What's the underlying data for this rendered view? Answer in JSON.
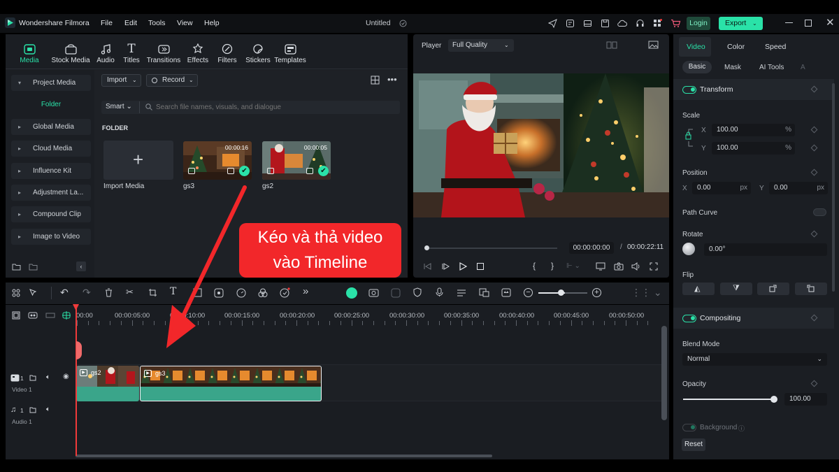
{
  "app": {
    "name": "Wondershare Filmora",
    "menu": [
      "File",
      "Edit",
      "Tools",
      "View",
      "Help"
    ],
    "doc_title": "Untitled",
    "login_label": "Login",
    "export_label": "Export"
  },
  "tools": [
    {
      "label": "Media",
      "icon": "media-icon"
    },
    {
      "label": "Stock Media",
      "icon": "stock-media-icon"
    },
    {
      "label": "Audio",
      "icon": "audio-icon"
    },
    {
      "label": "Titles",
      "icon": "titles-icon"
    },
    {
      "label": "Transitions",
      "icon": "transitions-icon"
    },
    {
      "label": "Effects",
      "icon": "effects-icon"
    },
    {
      "label": "Filters",
      "icon": "filters-icon"
    },
    {
      "label": "Stickers",
      "icon": "stickers-icon"
    },
    {
      "label": "Templates",
      "icon": "templates-icon"
    }
  ],
  "sidebar": {
    "project_media": "Project Media",
    "folder": "Folder",
    "items": [
      "Global Media",
      "Cloud Media",
      "Influence Kit",
      "Adjustment La...",
      "Compound Clip",
      "Image to Video"
    ]
  },
  "media": {
    "import_label": "Import",
    "record_label": "Record",
    "smart_label": "Smart",
    "search_placeholder": "Search file names, visuals, and dialogue",
    "folder_heading": "FOLDER",
    "import_media_label": "Import Media",
    "clips": [
      {
        "name": "gs3",
        "duration": "00:00:16"
      },
      {
        "name": "gs2",
        "duration": "00:00:05"
      }
    ]
  },
  "player": {
    "label": "Player",
    "quality": "Full Quality",
    "current_time": "00:00:00:00",
    "separator": "/",
    "total_time": "00:00:22:11"
  },
  "annotation": {
    "line1": "Kéo và thả video",
    "line2": "vào Timeline"
  },
  "inspector": {
    "tabs": [
      "Video",
      "Color",
      "Speed"
    ],
    "subtabs": [
      "Basic",
      "Mask",
      "AI Tools",
      "A"
    ],
    "transform_label": "Transform",
    "scale_label": "Scale",
    "scale_x": "100.00",
    "scale_y": "100.00",
    "x_label": "X",
    "y_label": "Y",
    "percent": "%",
    "position_label": "Position",
    "pos_x": "0.00",
    "pos_y": "0.00",
    "px": "px",
    "path_curve_label": "Path Curve",
    "rotate_label": "Rotate",
    "rotate_value": "0.00°",
    "flip_label": "Flip",
    "compositing_label": "Compositing",
    "blend_mode_label": "Blend Mode",
    "blend_mode_value": "Normal",
    "opacity_label": "Opacity",
    "opacity_value": "100.00",
    "opacity_fraction": 1.0,
    "background_label": "Background",
    "reset_label": "Reset"
  },
  "timeline": {
    "ruler": [
      "00:00",
      "00:00:05:00",
      "00:00:10:00",
      "00:00:15:00",
      "00:00:20:00",
      "00:00:25:00",
      "00:00:30:00",
      "00:00:35:00",
      "00:00:40:00",
      "00:00:45:00",
      "00:00:50:00"
    ],
    "video_track_label": "Video 1",
    "audio_track_label": "Audio 1",
    "track_number": "1",
    "clip_a_name": "gs2",
    "clip_b_name": "gs3"
  },
  "colors": {
    "accent": "#2ae2a8",
    "annotation_red": "#f2272a",
    "clip_teal": "#3aa58a",
    "playhead": "#f03a3a"
  }
}
